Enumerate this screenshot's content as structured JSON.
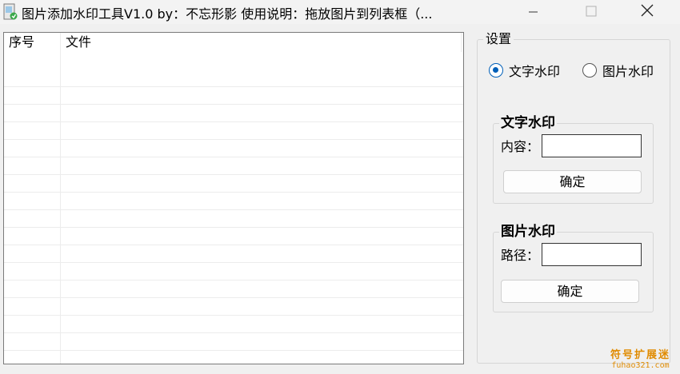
{
  "window": {
    "title": "图片添加水印工具V1.0   by：不忘形影     使用说明：拖放图片到列表框（...",
    "min_icon": "minimize-icon",
    "max_icon": "maximize-icon",
    "close_icon": "close-icon"
  },
  "file_list": {
    "columns": [
      "序号",
      "文件"
    ],
    "rows": []
  },
  "settings": {
    "legend": "设置",
    "mode_options": [
      {
        "label": "文字水印",
        "selected": true
      },
      {
        "label": "图片水印",
        "selected": false
      }
    ],
    "text_group": {
      "legend": "文字水印",
      "field_label": "内容：",
      "value": "",
      "button": "确定"
    },
    "image_group": {
      "legend": "图片水印",
      "field_label": "路径：",
      "value": "",
      "button": "确定"
    }
  },
  "watermark": {
    "cn": "符号扩展迷",
    "en": "fuhao321.com"
  },
  "colors": {
    "accent": "#005fb8",
    "watermark": "#e08b00"
  }
}
